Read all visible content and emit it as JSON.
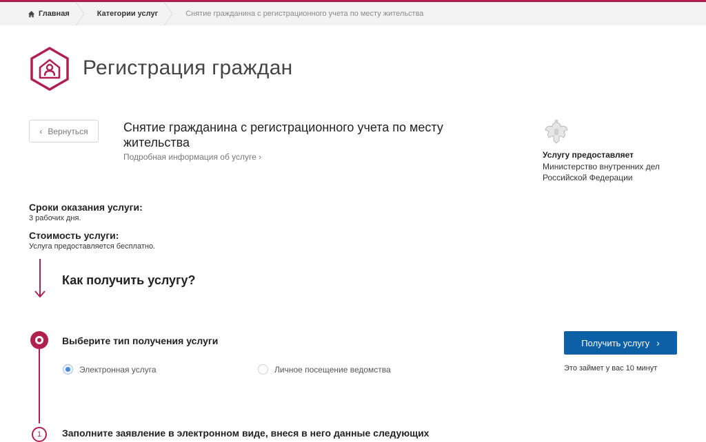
{
  "colors": {
    "accent": "#b11f4e",
    "primary_button": "#0d5fa6",
    "breadcrumb_bg": "#f3f3f3"
  },
  "breadcrumb": {
    "home": "Главная",
    "category": "Категории услуг",
    "current": "Снятие гражданина с регистрационного учета по месту жительства",
    "home_icon": "home-icon"
  },
  "header": {
    "title": "Регистрация граждан",
    "logo_icon": "house-person-icon"
  },
  "service": {
    "back_label": "Вернуться",
    "title": "Снятие гражданина с регистрационного учета по месту жительства",
    "details_link": "Подробная информация об услуге",
    "provider_label": "Услугу предоставляет",
    "provider_name": "Министерство внутренних дел Российской Федерации",
    "provider_icon": "coat-of-arms-icon"
  },
  "info": {
    "term_heading": "Сроки оказания услуги:",
    "term_value": "3 рабочих дня.",
    "cost_heading": "Стоимость услуги:",
    "cost_value": "Услуга предоставляется бесплатно."
  },
  "how": {
    "title": "Как получить услугу?",
    "step1_title": "Выберите тип получения услуги",
    "options": [
      {
        "label": "Электронная услуга",
        "checked": true
      },
      {
        "label": "Личное посещение ведомства",
        "checked": false
      }
    ],
    "get_button": "Получить услугу",
    "time_note": "Это займет у вас 10 минут",
    "step2_number": "1",
    "step2_title": "Заполните заявление в электронном виде, внеся в него данные следующих"
  }
}
